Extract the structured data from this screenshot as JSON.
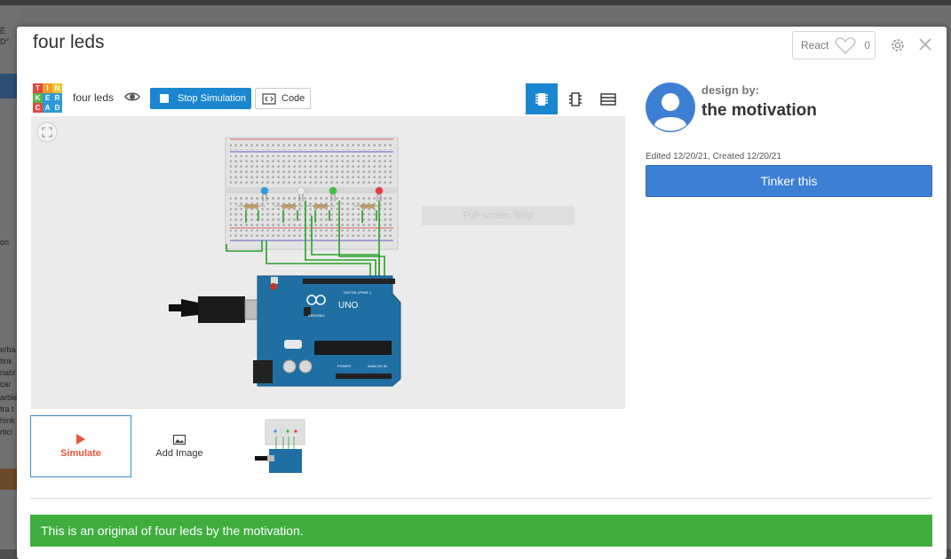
{
  "background": {
    "left_snippets": [
      "É",
      "D°",
      "on",
      "e/ba",
      "tink",
      "riabl",
      "car",
      "arble",
      "tra t",
      "hink",
      "rticl"
    ]
  },
  "modal": {
    "title": "four leds",
    "react_label": "React",
    "react_count": "0"
  },
  "toolbar": {
    "logo_letters": [
      "T",
      "I",
      "N",
      "K",
      "E",
      "R",
      "C",
      "A",
      "D"
    ],
    "logo_colors": [
      "#e2483d",
      "#f39c28",
      "#f0c330",
      "#58b548",
      "#2e9ad8",
      "#2e9ad8",
      "#e2483d",
      "#2e9ad8",
      "#2e9ad8"
    ],
    "project_name": "four leds",
    "stop_label": "Stop Simulation",
    "code_label": "Code"
  },
  "canvas": {
    "snip_label": "Full-screen Snip",
    "arduino_label": "UNO",
    "arduino_brand": "ARDUINO",
    "digital_label": "DIGITAL (PWM~)",
    "power_label": "POWER",
    "analog_label": "ANALOG IN",
    "led_colors": [
      "#2d9be6",
      "#e9e9e9",
      "#3bc43b",
      "#e83a3a"
    ]
  },
  "designer": {
    "design_by_label": "design by:",
    "name": "the motivation",
    "dates": "Edited 12/20/21, Created 12/20/21",
    "tinker_label": "Tinker this"
  },
  "thumbnails": {
    "simulate_label": "Simulate",
    "add_image_label": "Add Image"
  },
  "banner": {
    "text": "This is an original of four leds by the motivation."
  },
  "colors": {
    "accent": "#1a86d0",
    "tinker": "#3d7fd2",
    "banner": "#3fae3f",
    "simulate": "#e8563a"
  }
}
